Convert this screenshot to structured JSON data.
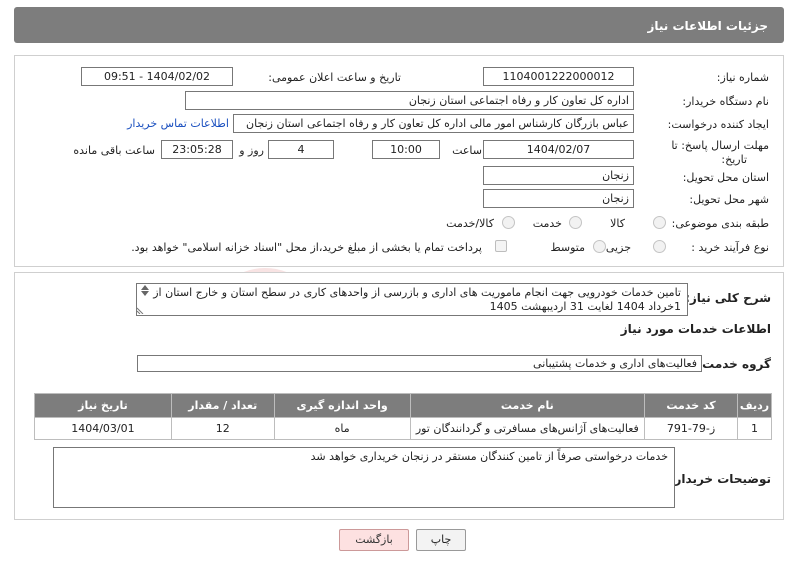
{
  "header": {
    "title": "جزئیات اطلاعات نیاز"
  },
  "form": {
    "need_number_label": "شماره نیاز:",
    "need_number": "1104001222000012",
    "announce_label": "تاریخ و ساعت اعلان عمومی:",
    "announce_value": "1404/02/02 - 09:51",
    "buyer_label": "نام دستگاه خریدار:",
    "buyer_value": "اداره کل تعاون  کار و رفاه اجتماعی استان زنجان",
    "creator_label": "ایجاد کننده درخواست:",
    "creator_value": "عباس بازرگان کارشناس امور مالی اداره کل تعاون  کار و رفاه اجتماعی استان زنجان",
    "contact_link": "اطلاعات تماس خریدار",
    "deadline_label_1": "مهلت ارسال پاسخ: تا",
    "deadline_label_2": "تاریخ:",
    "deadline_date": "1404/02/07",
    "time_label": "ساعت",
    "deadline_time": "10:00",
    "days_value": "4",
    "days_label": "روز و",
    "remaining_value": "23:05:28",
    "remaining_label": "ساعت باقی مانده",
    "province_label": "استان محل تحویل:",
    "province_value": "زنجان",
    "city_label": "شهر محل تحویل:",
    "city_value": "زنجان",
    "category_label": "طبقه بندی موضوعی:",
    "category_options": [
      "کالا",
      "خدمت",
      "کالا/خدمت"
    ],
    "process_label": "نوع فرآیند خرید :",
    "process_options": [
      "جزیی",
      "متوسط"
    ],
    "payment_note": "پرداخت تمام یا بخشی از مبلغ خرید،از محل \"اسناد خزانه اسلامی\" خواهد بود."
  },
  "description": {
    "label": "شرح کلی نیاز:",
    "text": "تامین خدمات خودرویی جهت انجام ماموریت های اداری و بازرسی از واحدهای کاری در سطح استان و خارج استان از 1خرداد 1404 لغایت 31 اردیبهشت 1405"
  },
  "services": {
    "section_title": "اطلاعات خدمات مورد نیاز",
    "group_label": "گروه خدمت:",
    "group_value": "فعالیت‌های اداری و خدمات پشتیبانی",
    "columns": [
      "ردیف",
      "کد خدمت",
      "نام خدمت",
      "واحد اندازه گیری",
      "تعداد / مقدار",
      "تاریخ نیاز"
    ],
    "rows": [
      [
        "1",
        "ز-79-791",
        "فعالیت‌های آژانس‌های مسافرتی و گردانندگان تور",
        "ماه",
        "12",
        "1404/03/01"
      ]
    ]
  },
  "buyer_notes": {
    "label": "توضیحات خریدار:",
    "text": "خدمات درخواستی صرفاً از تامین کنندگان مستقر در زنجان خریداری خواهد شد"
  },
  "buttons": {
    "print": "چاپ",
    "back": "بازگشت"
  },
  "colors": {
    "header_bg": "#7d7d7d",
    "link": "#1a4fbf",
    "back_button_bg": "#fde1e1"
  }
}
